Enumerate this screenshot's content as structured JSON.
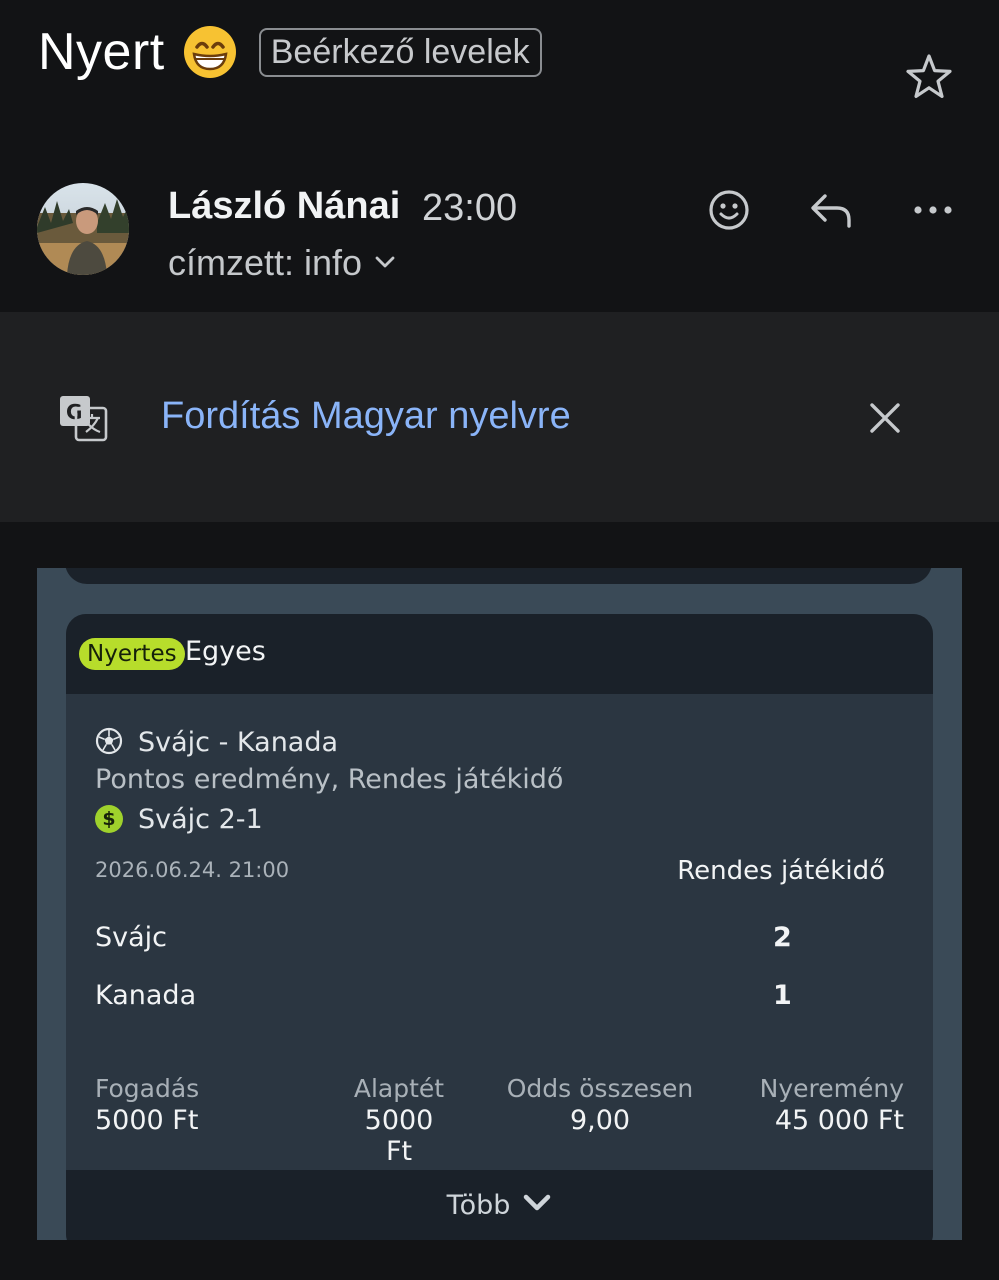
{
  "header": {
    "subject": "Nyert",
    "label_chip": "Beérkező levelek"
  },
  "message": {
    "sender": "László Nánai",
    "time": "23:00",
    "recipient": "címzett: info"
  },
  "translate": {
    "text": "Fordítás Magyar nyelvre"
  },
  "bet": {
    "badge": "Nyertes",
    "type": "Egyes",
    "match": "Svájc - Kanada",
    "market": "Pontos eredmény, Rendes játékidő",
    "selection": "Svájc 2-1",
    "datetime": "2026.06.24.  21:00",
    "period": "Rendes játékidő",
    "teams": [
      {
        "name": "Svájc",
        "score": "2"
      },
      {
        "name": "Kanada",
        "score": "1"
      }
    ],
    "stats": [
      {
        "label": "Fogadás",
        "value": "5000 Ft"
      },
      {
        "label": "Alaptét",
        "value": "5000 Ft"
      },
      {
        "label": "Odds összesen",
        "value": "9,00"
      },
      {
        "label": "Nyeremény",
        "value": "45 000 Ft"
      }
    ],
    "more": "Több"
  },
  "icons": [
    "grinning-emoji-icon",
    "star-icon",
    "emoji-reaction-icon",
    "reply-icon",
    "more-options-icon",
    "chevron-down-icon",
    "translate-icon",
    "close-icon",
    "soccer-ball-icon",
    "dollar-icon"
  ],
  "colors": {
    "background": "#121315",
    "link": "#8ab4f8",
    "win_badge": "#b7dd2b",
    "card": "#2b3641"
  }
}
